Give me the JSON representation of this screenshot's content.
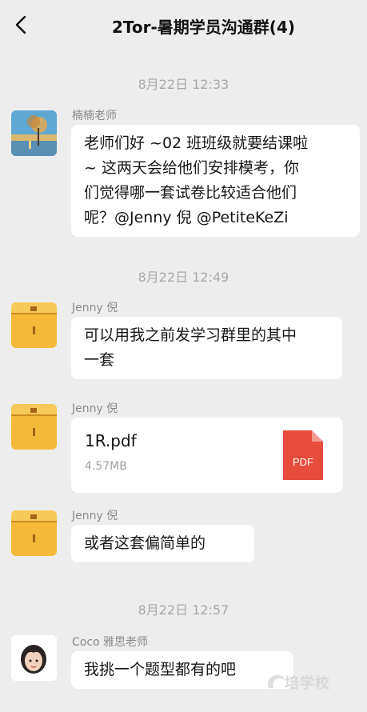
{
  "header": {
    "back_icon": "chevron-left-icon",
    "title": "2Tor-暑期学员沟通群(4)"
  },
  "messages": [
    {
      "type": "time",
      "text": "8月22日 12:33"
    },
    {
      "type": "text",
      "sender": "楠楠老师",
      "avatar": "landscape-avatar",
      "lines": [
        "老师们好 ~02 班班级就要结课啦",
        "~ 这两天会给他们安排模考，你",
        "们觉得哪一套试卷比较适合他们",
        "呢？@Jenny 倪 @PetiteKeZi"
      ]
    },
    {
      "type": "time",
      "text": "8月22日 12:49"
    },
    {
      "type": "text",
      "sender": "Jenny 倪",
      "avatar": "box-avatar",
      "lines": [
        "可以用我之前发学习群里的其中",
        "一套"
      ]
    },
    {
      "type": "file",
      "sender": "Jenny 倪",
      "avatar": "box-avatar",
      "file_name": "1R.pdf",
      "file_size": "4.57MB",
      "file_icon_label": "PDF",
      "file_icon_color": "#e74c3c"
    },
    {
      "type": "text",
      "sender": "Jenny 倪",
      "avatar": "box-avatar",
      "lines": [
        "或者这套偏简单的"
      ]
    },
    {
      "type": "time",
      "text": "8月22日 12:57"
    },
    {
      "type": "text",
      "sender": "Coco 雅思老师",
      "avatar": "memoji-avatar",
      "lines": [
        "我挑一个题型都有的吧"
      ]
    }
  ],
  "watermark": "培学校",
  "colors": {
    "background": "#ededed",
    "bubble": "#ffffff",
    "pdf": "#e74c3c",
    "timestamp": "#a8a8a8"
  }
}
